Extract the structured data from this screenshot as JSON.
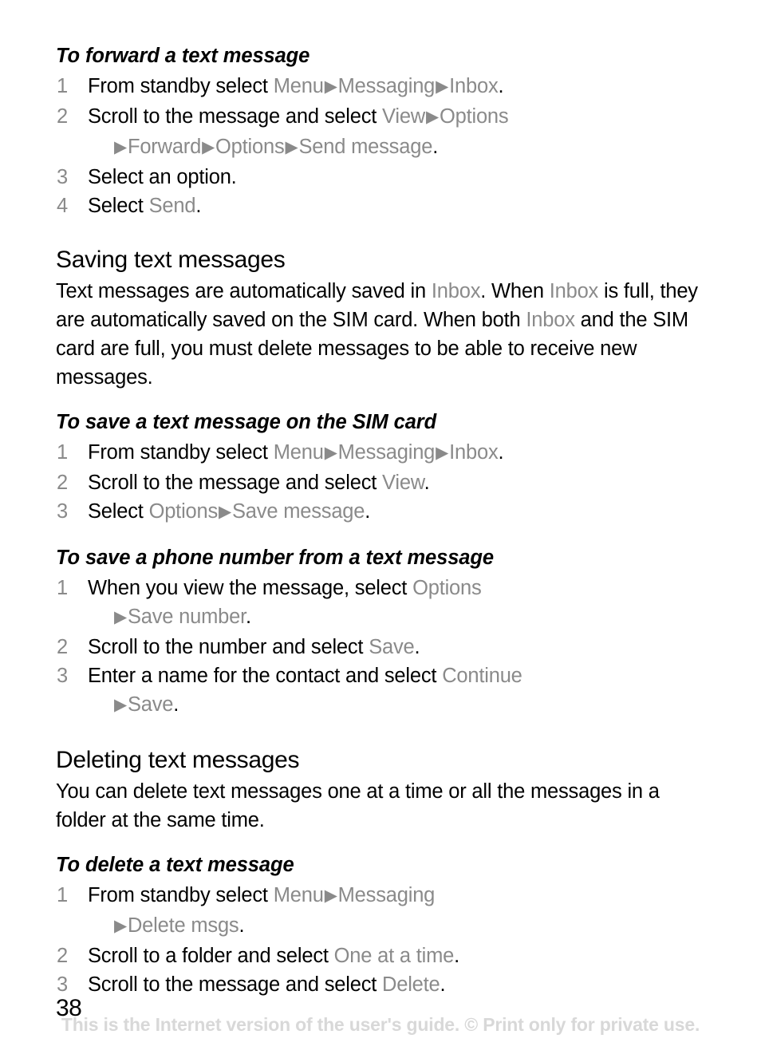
{
  "document": {
    "page_number": "38",
    "footer_watermark": "This is the Internet version of the user's guide. © Print only for private use.",
    "colors": {
      "text": "#000000",
      "ui_term_gray": "#8a8a8a",
      "watermark_gray": "#d8d8d8",
      "background": "#ffffff"
    }
  },
  "arrow_glyph": "▶",
  "blocks": {
    "forward_proc": {
      "heading": "To forward a text message",
      "steps": {
        "s1": {
          "num": "1",
          "t1": "From standby select ",
          "ui1": "Menu",
          "ui2": "Messaging",
          "ui3": "Inbox",
          "end": "."
        },
        "s2": {
          "num": "2",
          "t1": "Scroll to the message and select ",
          "ui1": "View",
          "ui2": "Options",
          "ui3": "Forward",
          "ui4": "Options",
          "ui5": "Send message",
          "end": "."
        },
        "s3": {
          "num": "3",
          "t1": "Select an option."
        },
        "s4": {
          "num": "4",
          "t1": "Select ",
          "ui1": "Send",
          "end": "."
        }
      }
    },
    "saving_section": {
      "heading": "Saving text messages",
      "para": {
        "p1": "Text messages are automatically saved in ",
        "ui1": "Inbox",
        "p2": ". When ",
        "ui2": "Inbox",
        "p3": " is full, they are automatically saved on the SIM card. When both ",
        "ui3": "Inbox",
        "p4": " and the SIM card are full, you must delete messages to be able to receive new messages."
      }
    },
    "save_sim_proc": {
      "heading": "To save a text message on the SIM card",
      "steps": {
        "s1": {
          "num": "1",
          "t1": "From standby select ",
          "ui1": "Menu",
          "ui2": "Messaging",
          "ui3": "Inbox",
          "end": "."
        },
        "s2": {
          "num": "2",
          "t1": "Scroll to the message and select ",
          "ui1": "View",
          "end": "."
        },
        "s3": {
          "num": "3",
          "t1": "Select ",
          "ui1": "Options",
          "ui2": "Save message",
          "end": "."
        }
      }
    },
    "save_number_proc": {
      "heading": "To save a phone number from a text message",
      "steps": {
        "s1": {
          "num": "1",
          "t1": "When you view the message, select ",
          "ui1": "Options",
          "ui2": "Save number",
          "end": "."
        },
        "s2": {
          "num": "2",
          "t1": "Scroll to the number and select ",
          "ui1": "Save",
          "end": "."
        },
        "s3": {
          "num": "3",
          "t1": "Enter a name for the contact and select ",
          "ui1": "Continue",
          "ui2": "Save",
          "end": "."
        }
      }
    },
    "deleting_section": {
      "heading": "Deleting text messages",
      "para": {
        "p1": "You can delete text messages one at a time or all the messages in a folder at the same time."
      }
    },
    "delete_proc": {
      "heading": "To delete a text message",
      "steps": {
        "s1": {
          "num": "1",
          "t1": "From standby select ",
          "ui1": "Menu",
          "ui2": "Messaging",
          "ui3": "Delete msgs",
          "end": "."
        },
        "s2": {
          "num": "2",
          "t1": "Scroll to a folder and select ",
          "ui1": "One at a time",
          "end": "."
        },
        "s3": {
          "num": "3",
          "t1": "Scroll to the message and select ",
          "ui1": "Delete",
          "end": "."
        }
      }
    }
  }
}
